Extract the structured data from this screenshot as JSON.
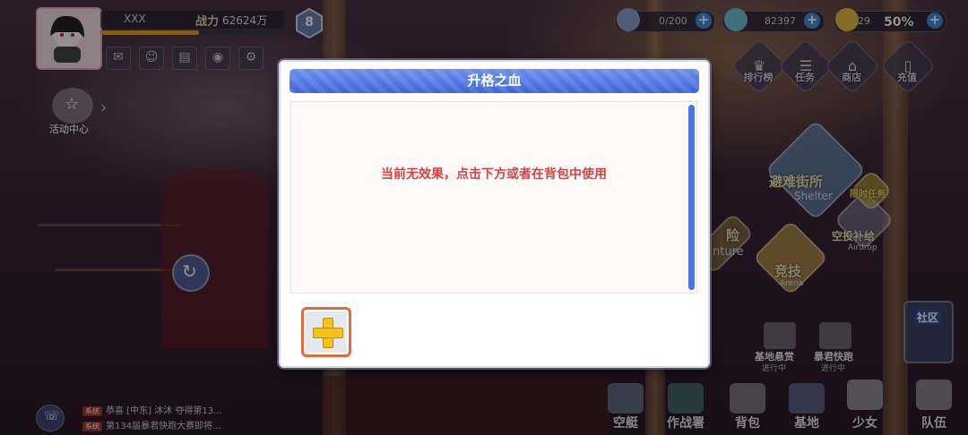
{
  "player": {
    "name": "XXX",
    "power_label": "战力",
    "power_value": "62624万",
    "level_badge": "8"
  },
  "resources": [
    {
      "name": "stamina",
      "value": "0/200",
      "icon": "bullet-icon"
    },
    {
      "name": "gold",
      "value": "82397",
      "icon": "coin-icon"
    },
    {
      "name": "gems",
      "value": "29",
      "icon": "gem-icon"
    }
  ],
  "battery": "50%",
  "top_nav": [
    {
      "label": "排行榜",
      "icon": "trophy-icon"
    },
    {
      "label": "任务",
      "icon": "task-icon"
    },
    {
      "label": "商店",
      "icon": "shop-icon"
    },
    {
      "label": "充值",
      "icon": "recharge-icon"
    }
  ],
  "left_side": {
    "activity_label": "活动中心"
  },
  "map_nodes": [
    {
      "label": "避难街所",
      "sub": "Shelter"
    },
    {
      "label": "险",
      "sub": "nture"
    },
    {
      "label": "竞技",
      "sub": "Arena"
    },
    {
      "label": "空投补给",
      "sub": "Airdrop"
    },
    {
      "label": "限时任务",
      "sub": ""
    }
  ],
  "base_status": [
    {
      "label": "基地悬赏",
      "status": "进行中"
    },
    {
      "label": "暴君快跑",
      "status": "进行中"
    }
  ],
  "community_label": "社区",
  "chat": [
    {
      "tag": "系统",
      "text": "恭喜 [中东] 沐沐 夺得第13..."
    },
    {
      "tag": "系统",
      "text": "第134届暴君快跑大赛即将..."
    }
  ],
  "bottom_nav": [
    {
      "label": "空艇",
      "icon": "airship-icon"
    },
    {
      "label": "作战署",
      "icon": "hq-icon"
    },
    {
      "label": "背包",
      "icon": "backpack-icon"
    },
    {
      "label": "基地",
      "icon": "base-icon"
    },
    {
      "label": "少女",
      "icon": "girl-icon"
    },
    {
      "label": "队伍",
      "icon": "team-icon"
    }
  ],
  "dialog": {
    "title": "升格之血",
    "effect_text": "当前无效果，点击下方或者在背包中使用",
    "add_button_icon": "plus-icon"
  },
  "colors": {
    "title_bar": "#4a6fe0",
    "effect_text": "#d94040",
    "slot_border": "#e46a3a",
    "plus": "#f4c21a"
  }
}
